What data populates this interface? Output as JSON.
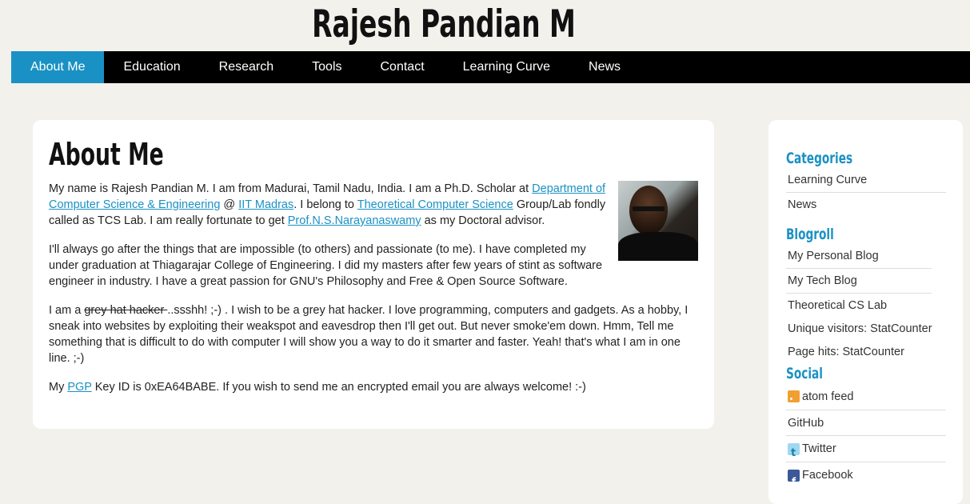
{
  "site": {
    "title": "Rajesh Pandian M"
  },
  "nav": {
    "items": [
      "About Me",
      "Education",
      "Research",
      "Tools",
      "Contact",
      "Learning Curve",
      "News"
    ]
  },
  "main": {
    "heading": "About Me",
    "p1": {
      "t1": "My name is Rajesh Pandian M. I am from Madurai, Tamil Nadu, India. I am a Ph.D. Scholar at ",
      "link_dept": "Department of Computer Science & Engineering",
      "t2": " @ ",
      "link_iit": "IIT Madras",
      "t3": ". I belong to ",
      "link_tcs": "Theoretical Computer Science",
      "t4": " Group/Lab fondly called as TCS Lab. I am really fortunate to get ",
      "link_prof": "Prof.N.S.Narayanaswamy",
      "t5": " as my Doctoral advisor."
    },
    "p2": "I'll always go after the things that are impossible (to others) and passionate (to me). I have completed my under graduation at Thiagarajar College of Engineering. I did my masters after few years of stint as software engineer in industry. I have a great passion for GNU's Philosophy and Free & Open Source Software.",
    "p3": {
      "t1": "I am a ",
      "strike": "grey hat hacker ",
      "t2": "..ssshh! ;-) . I wish to be a grey hat hacker. I love programming, computers and gadgets. As a hobby, I sneak into websites by exploiting their weakspot and eavesdrop then I'll get out. But never smoke'em down. Hmm, Tell me something that is difficult to do with computer I will show you a way to do it smarter and faster. Yeah! that's what I am in one line. ;-)"
    },
    "p4": {
      "t1": "My ",
      "link_pgp": "PGP",
      "t2": " Key ID is 0xEA64BABE. If you wish to send me an encrypted email you are always welcome! :-)"
    }
  },
  "sidebar": {
    "categories_heading": "Categories",
    "categories": [
      "Learning Curve",
      "News"
    ],
    "blogroll_heading": "Blogroll",
    "blogroll": [
      "My Personal Blog",
      "My Tech Blog",
      "Theoretical CS Lab"
    ],
    "stats": [
      "Unique visitors: StatCounter",
      "Page hits: StatCounter"
    ],
    "social_heading": "Social",
    "social": [
      "atom feed",
      "GitHub",
      "Twitter",
      "Facebook"
    ]
  },
  "colors": {
    "accent": "#1a91c4",
    "nav_bg": "#000000",
    "page_bg": "#f3f1ec"
  }
}
